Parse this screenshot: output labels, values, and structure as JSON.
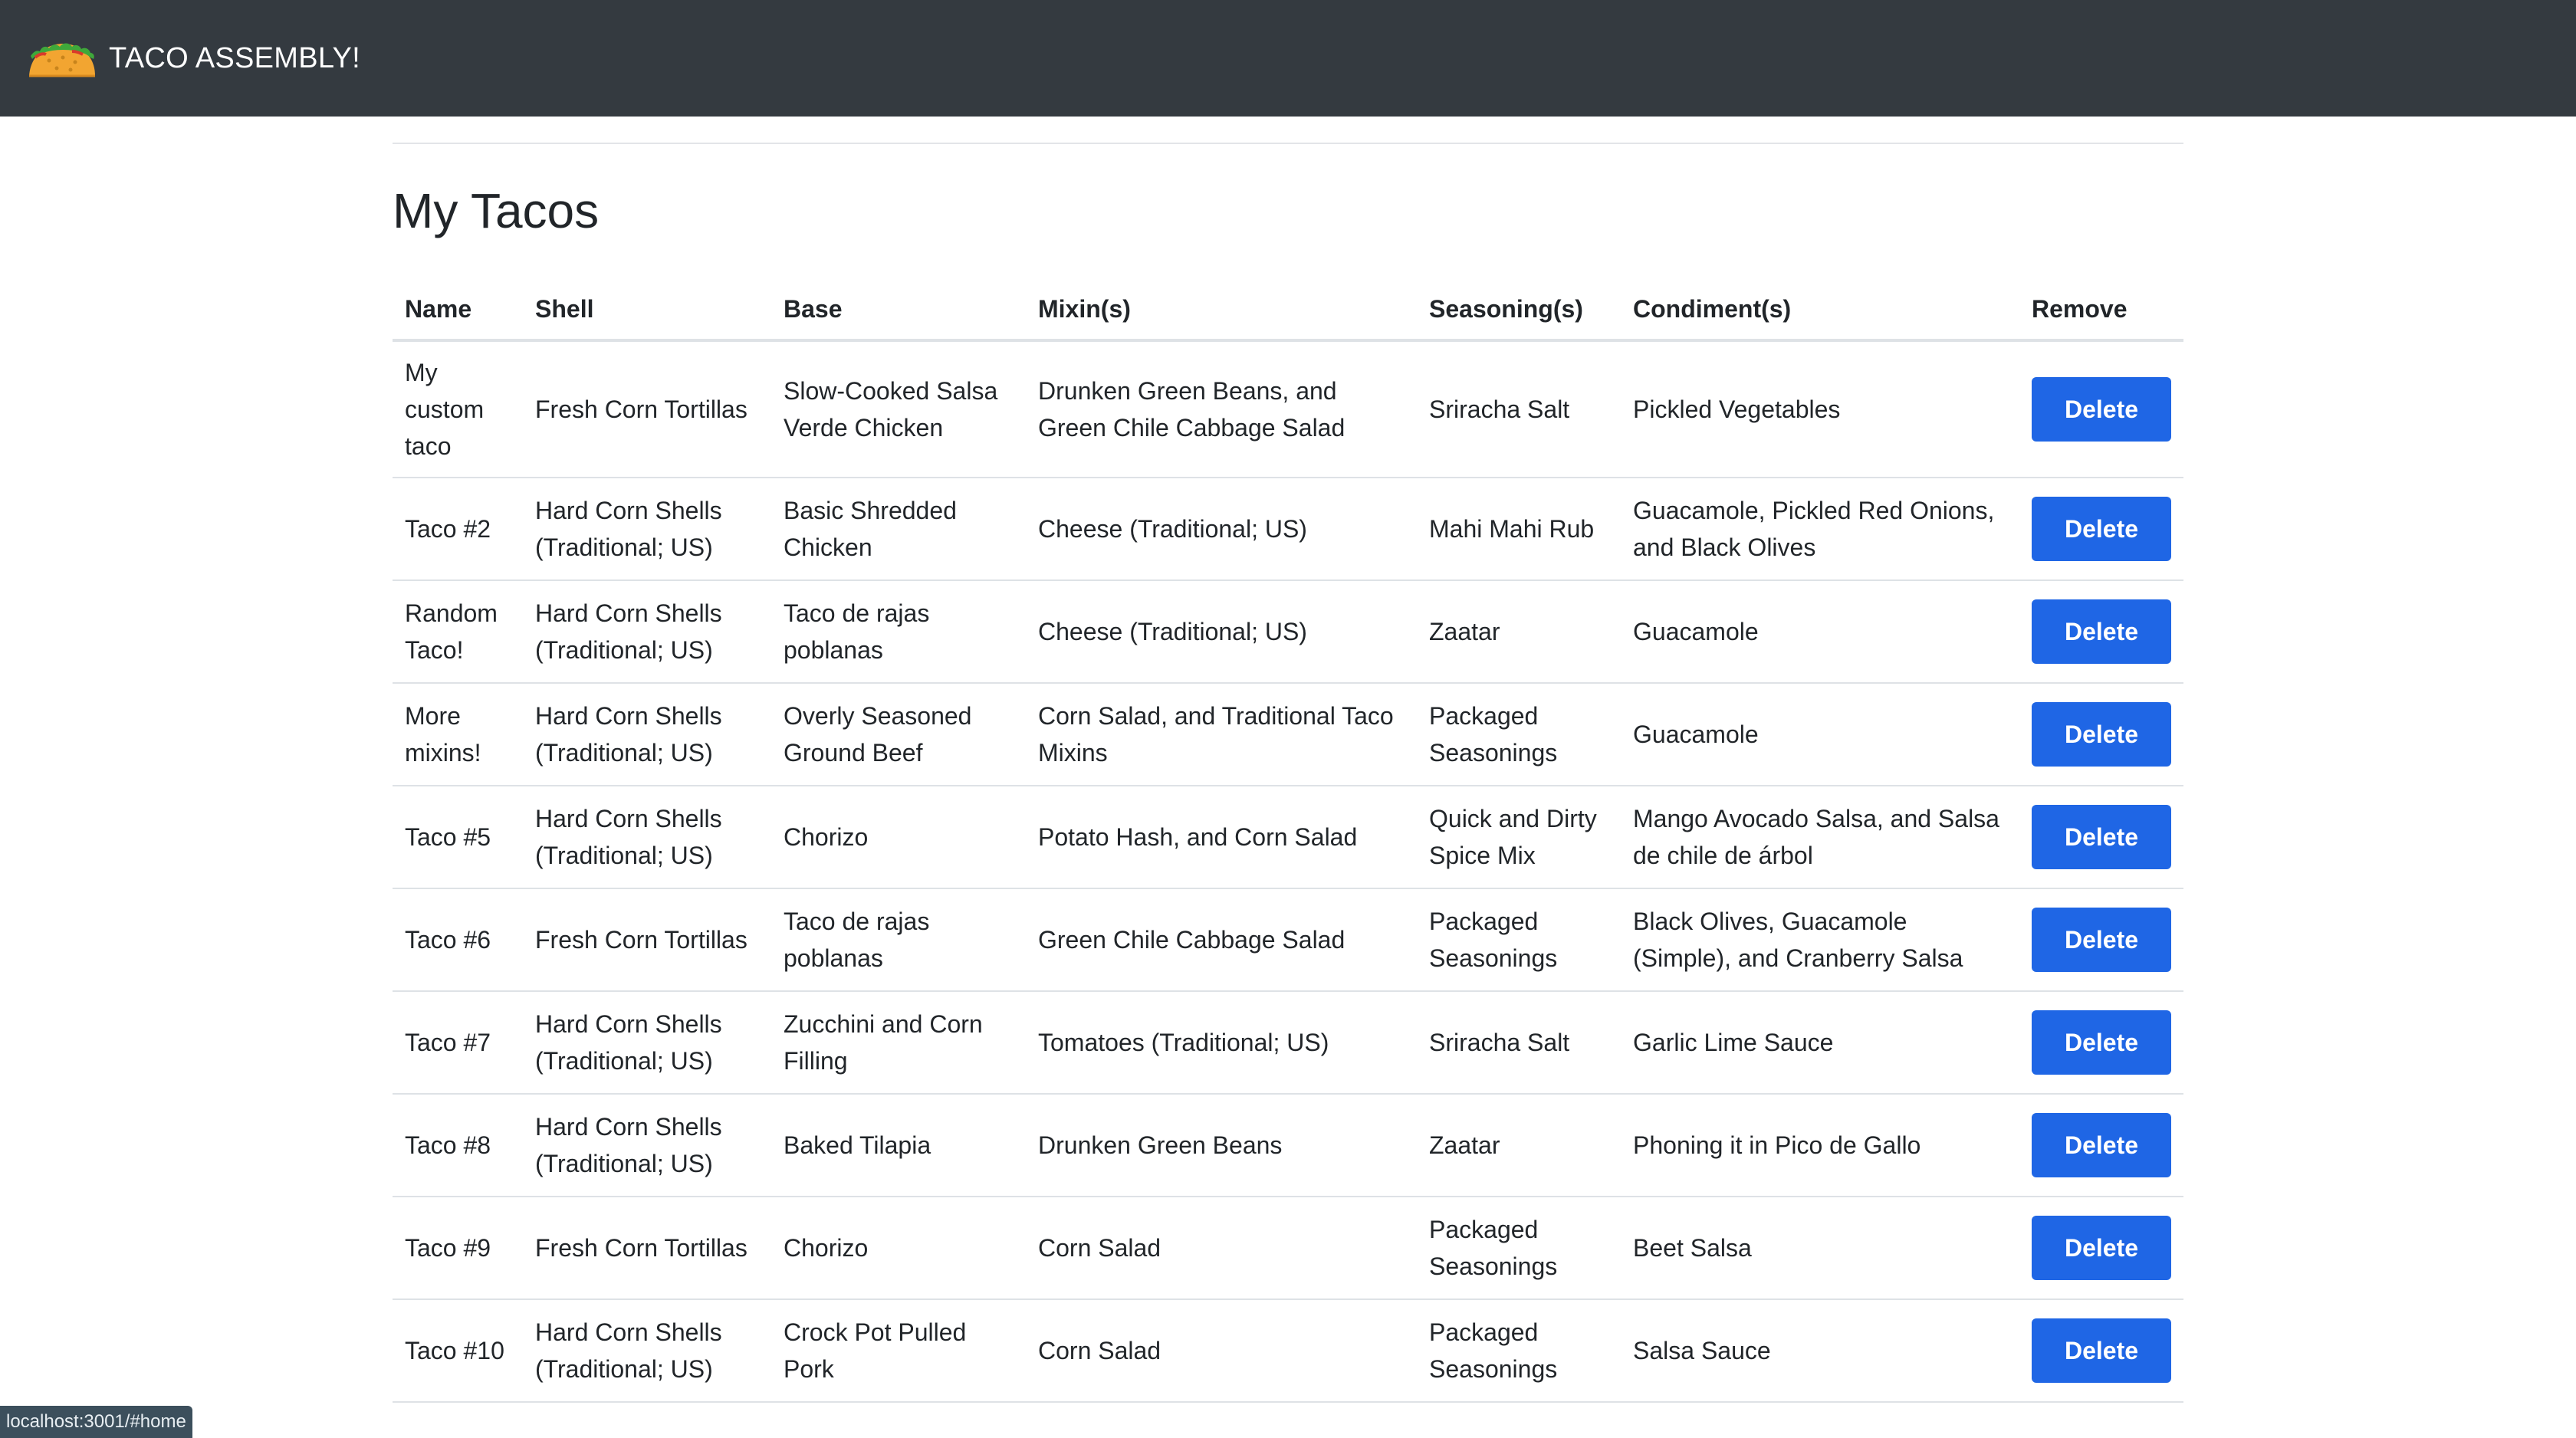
{
  "navbar": {
    "brand_text": "TACO ASSEMBLY!",
    "logo_icon": "taco-icon",
    "background": "#343a40"
  },
  "main": {
    "title": "My Tacos"
  },
  "table": {
    "headers": [
      "Name",
      "Shell",
      "Base",
      "Mixin(s)",
      "Seasoning(s)",
      "Condiment(s)",
      "Remove"
    ],
    "delete_label": "Delete",
    "delete_color": "#1f66e5",
    "rows": [
      {
        "name": "My custom taco",
        "shell": "Fresh Corn Tortillas",
        "base": "Slow-Cooked Salsa Verde Chicken",
        "mixins": "Drunken Green Beans, and Green Chile Cabbage Salad",
        "seasonings": "Sriracha Salt",
        "condiments": "Pickled Vegetables"
      },
      {
        "name": "Taco #2",
        "shell": "Hard Corn Shells (Traditional; US)",
        "base": "Basic Shredded Chicken",
        "mixins": "Cheese (Traditional; US)",
        "seasonings": "Mahi Mahi Rub",
        "condiments": "Guacamole, Pickled Red Onions, and Black Olives"
      },
      {
        "name": "Random Taco!",
        "shell": "Hard Corn Shells (Traditional; US)",
        "base": "Taco de rajas poblanas",
        "mixins": "Cheese (Traditional; US)",
        "seasonings": "Zaatar",
        "condiments": "Guacamole"
      },
      {
        "name": "More mixins!",
        "shell": "Hard Corn Shells (Traditional; US)",
        "base": "Overly Seasoned Ground Beef",
        "mixins": "Corn Salad, and Traditional Taco Mixins",
        "seasonings": "Packaged Seasonings",
        "condiments": "Guacamole"
      },
      {
        "name": "Taco #5",
        "shell": "Hard Corn Shells (Traditional; US)",
        "base": "Chorizo",
        "mixins": "Potato Hash, and Corn Salad",
        "seasonings": "Quick and Dirty Spice Mix",
        "condiments": "Mango Avocado Salsa, and Salsa de chile de árbol"
      },
      {
        "name": "Taco #6",
        "shell": "Fresh Corn Tortillas",
        "base": "Taco de rajas poblanas",
        "mixins": "Green Chile Cabbage Salad",
        "seasonings": "Packaged Seasonings",
        "condiments": "Black Olives, Guacamole (Simple), and Cranberry Salsa"
      },
      {
        "name": "Taco #7",
        "shell": "Hard Corn Shells (Traditional; US)",
        "base": "Zucchini and Corn Filling",
        "mixins": "Tomatoes (Traditional; US)",
        "seasonings": "Sriracha Salt",
        "condiments": "Garlic Lime Sauce"
      },
      {
        "name": "Taco #8",
        "shell": "Hard Corn Shells (Traditional; US)",
        "base": "Baked Tilapia",
        "mixins": "Drunken Green Beans",
        "seasonings": "Zaatar",
        "condiments": "Phoning it in Pico de Gallo"
      },
      {
        "name": "Taco #9",
        "shell": "Fresh Corn Tortillas",
        "base": "Chorizo",
        "mixins": "Corn Salad",
        "seasonings": "Packaged Seasonings",
        "condiments": "Beet Salsa"
      },
      {
        "name": "Taco #10",
        "shell": "Hard Corn Shells (Traditional; US)",
        "base": "Crock Pot Pulled Pork",
        "mixins": "Corn Salad",
        "seasonings": "Packaged Seasonings",
        "condiments": "Salsa Sauce"
      }
    ]
  },
  "status_bar": {
    "url": "localhost:3001/#home"
  }
}
